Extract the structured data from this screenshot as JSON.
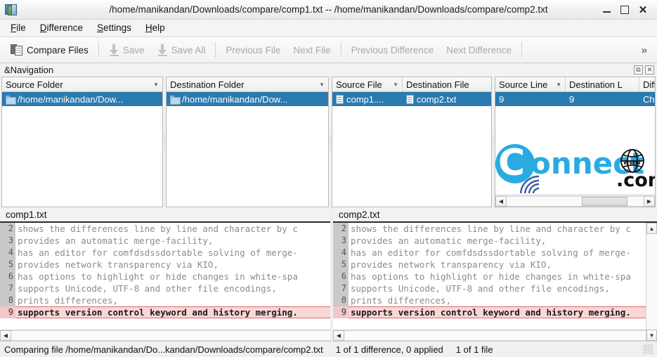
{
  "window": {
    "title": "/home/manikandan/Downloads/compare/comp1.txt -- /home/manikandan/Downloads/compare/comp2.txt",
    "app_icon": "kdiff3-icon",
    "minimize_label": "",
    "maximize_label": "",
    "close_label": "✕"
  },
  "menubar": {
    "items": [
      {
        "acc": "F",
        "rest": "ile"
      },
      {
        "acc": "D",
        "rest": "ifference"
      },
      {
        "acc": "S",
        "rest": "ettings"
      },
      {
        "acc": "H",
        "rest": "elp"
      }
    ]
  },
  "toolbar": {
    "compare_files_label": "Compare Files",
    "save_label": "Save",
    "save_all_label": "Save All",
    "previous_file_label": "Previous File",
    "next_file_label": "Next File",
    "previous_difference_label": "Previous Difference",
    "next_difference_label": "Next Difference",
    "overflow_label": "»"
  },
  "navigation": {
    "dock_title": "&Navigation",
    "float_button": "⧉",
    "close_button": "✕",
    "columns": [
      {
        "header": "Source Folder",
        "sortable": true,
        "value": "/home/manikandan/Dow...",
        "icon": "folder-icon"
      },
      {
        "header": "Destination Folder",
        "sortable": true,
        "value": "/home/manikandan/Dow...",
        "icon": "folder-icon"
      },
      {
        "header": "Source File",
        "sortable": true,
        "value": "comp1....",
        "icon": "file-icon"
      },
      {
        "header": "Destination File",
        "sortable": false,
        "value": "comp2.txt",
        "icon": "file-icon"
      },
      {
        "header": "Source Line",
        "sortable": true,
        "value": "9",
        "icon": ""
      },
      {
        "header": "Destination L",
        "sortable": false,
        "value": "9",
        "icon": ""
      },
      {
        "header": "Diff",
        "sortable": false,
        "value": "Cha",
        "icon": ""
      }
    ],
    "watermark": {
      "brand_c": "C",
      "brand_rest": "onnect",
      "globe_text": "www",
      "brand_tld": ".com"
    },
    "hscroll": {
      "left_arrow": "◀",
      "right_arrow": "▶"
    }
  },
  "diff": {
    "left": {
      "filename": "comp1.txt",
      "lines": [
        {
          "n": "2",
          "text": "shows the differences line by line and character by c"
        },
        {
          "n": "3",
          "text": "provides an automatic merge-facility,"
        },
        {
          "n": "4",
          "text": "has an editor for comfdsdssdortable solving of merge-"
        },
        {
          "n": "5",
          "text": "provides network transparency via KIO,"
        },
        {
          "n": "6",
          "text": "has options to highlight or hide changes in white-spa"
        },
        {
          "n": "7",
          "text": "supports Unicode, UTF-8 and other file encodings,"
        },
        {
          "n": "8",
          "text": "prints differences,"
        },
        {
          "n": "9",
          "text": "supports version control keyword and history merging.",
          "changed": true
        }
      ]
    },
    "right": {
      "filename": "comp2.txt",
      "lines": [
        {
          "n": "2",
          "text": "shows the differences line by line and character by c"
        },
        {
          "n": "3",
          "text": "provides an automatic merge-facility,"
        },
        {
          "n": "4",
          "text": "has an editor for comfdsdssdortable solving of merge-"
        },
        {
          "n": "5",
          "text": "provides network transparency via KIO,"
        },
        {
          "n": "6",
          "text": "has options to highlight or hide changes in white-spa"
        },
        {
          "n": "7",
          "text": "supports Unicode, UTF-8 and other file encodings,"
        },
        {
          "n": "8",
          "text": "prints differences,"
        },
        {
          "n": "9",
          "text": "supports version control keyword and history merging.",
          "changed": true
        }
      ]
    },
    "scroll": {
      "up_arrow": "▲",
      "down_arrow": "▼",
      "left_arrow": "◀"
    }
  },
  "statusbar": {
    "comparing": "Comparing file /home/manikandan/Do...kandan/Downloads/compare/comp2.txt",
    "differences": "1 of 1 difference, 0 applied",
    "files": "1 of 1 file"
  },
  "colors": {
    "selection_blue": "#2a7ab0",
    "diff_pink": "#fbd6d6",
    "diff_border_red": "#e06666",
    "brand_cyan": "#29abe2"
  }
}
